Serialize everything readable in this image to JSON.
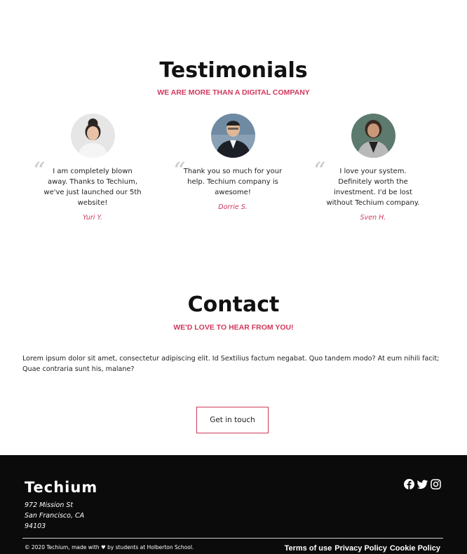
{
  "testimonials": {
    "title": "Testimonials",
    "subtitle": "WE ARE MORE THAN A DIGITAL COMPANY",
    "items": [
      {
        "quote": "I am completely blown away. Thanks to Techium, we've just launched our 5th website!",
        "author": "Yuri Y."
      },
      {
        "quote": "Thank you so much for your help. Techium company is awesome!",
        "author": "Dorrie S."
      },
      {
        "quote": "I love your system. Definitely worth the investment. I'd be lost without Techium company.",
        "author": "Sven H."
      }
    ]
  },
  "contact": {
    "title": "Contact",
    "subtitle": "WE'D LOVE TO HEAR FROM YOU!",
    "body": "Lorem ipsum dolor sit amet, consectetur adipiscing elit. Id Sextilius factum negabat. Quo tandem modo? At eum nihili facit; Quae contraria sunt his, malane?",
    "button_label": "Get in touch"
  },
  "footer": {
    "brand": "Techium",
    "address_line1": "972 Mission St",
    "address_line2": "San Francisco, CA",
    "address_line3": "94103",
    "copyright": "© 2020 Techium, made with ♥ by students at Holberton School.",
    "links": [
      "Terms of use",
      "Privacy Policy",
      "Cookie Policy"
    ],
    "social_icons": [
      "facebook-icon",
      "twitter-icon",
      "instagram-icon"
    ]
  },
  "colors": {
    "accent": "#d1385c",
    "footer_bg": "#0b0b0b"
  }
}
